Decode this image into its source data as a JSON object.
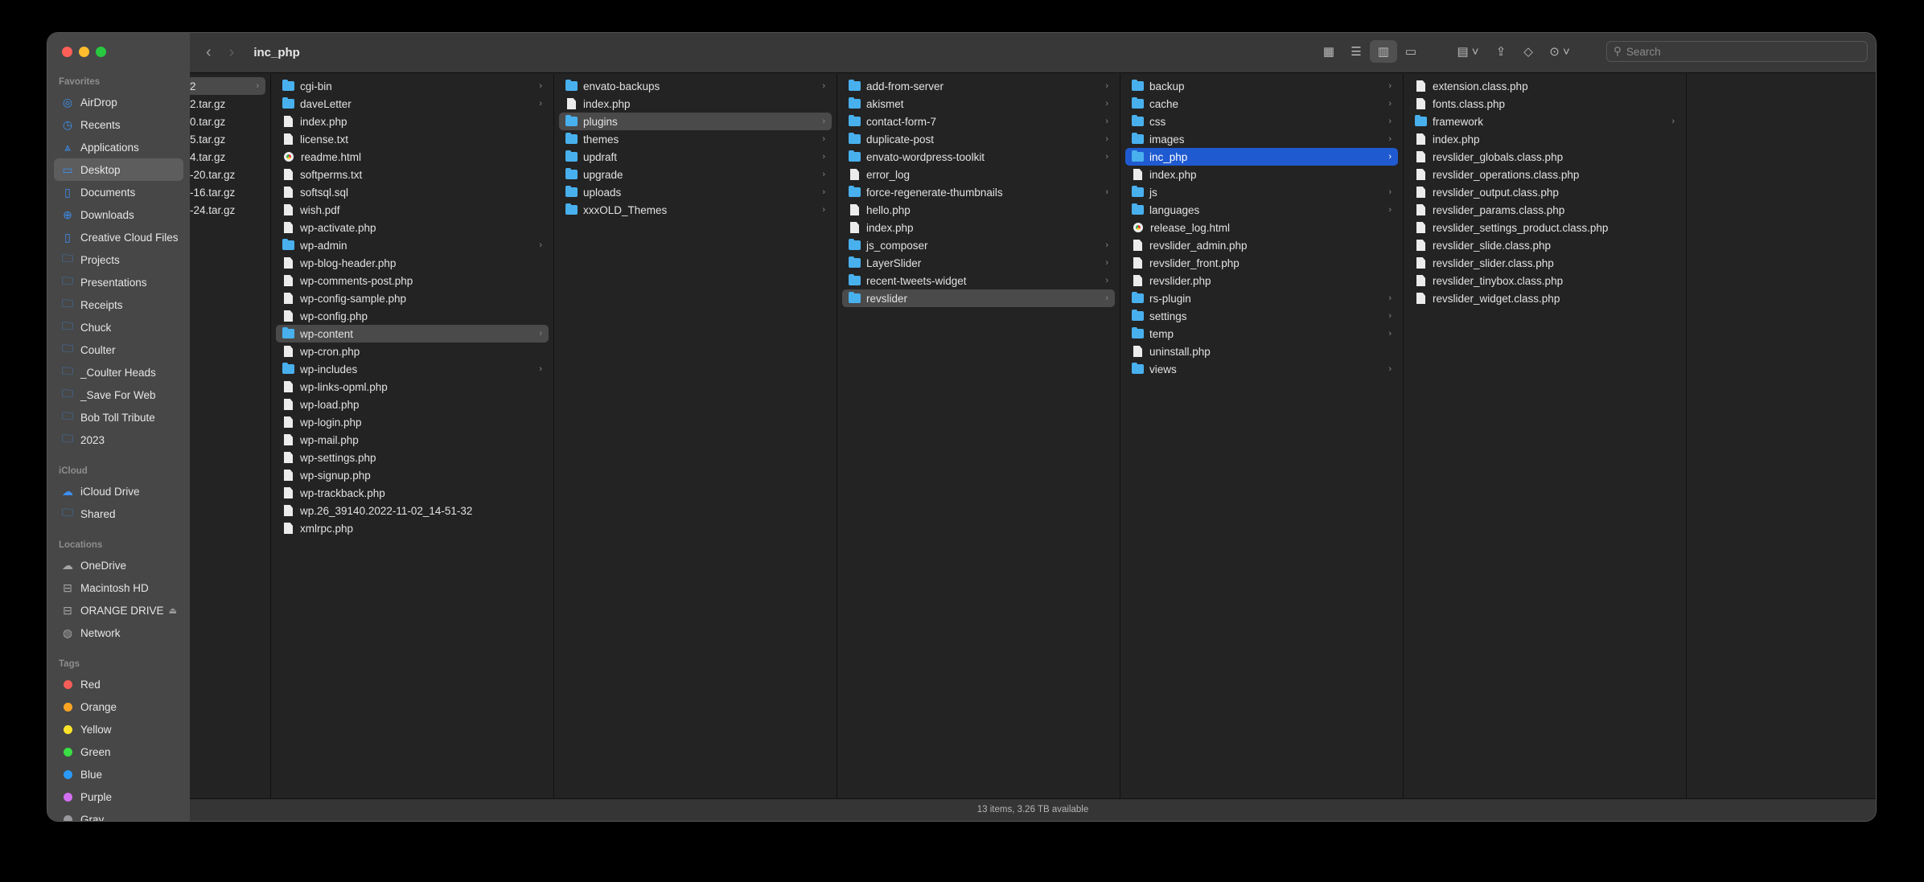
{
  "window": {
    "title": "inc_php",
    "status": "13 items, 3.26 TB available",
    "search_placeholder": "Search"
  },
  "sidebar": {
    "favorites_label": "Favorites",
    "favorites": [
      {
        "label": "AirDrop",
        "icon": "airdrop-icon",
        "glyph": "◎"
      },
      {
        "label": "Recents",
        "icon": "clock-icon",
        "glyph": "◷"
      },
      {
        "label": "Applications",
        "icon": "applications-icon",
        "glyph": "⩓"
      },
      {
        "label": "Desktop",
        "icon": "desktop-icon",
        "glyph": "▭",
        "selected": true
      },
      {
        "label": "Documents",
        "icon": "document-icon",
        "glyph": "▯"
      },
      {
        "label": "Downloads",
        "icon": "download-icon",
        "glyph": "⊕"
      },
      {
        "label": "Creative Cloud Files",
        "icon": "document-icon",
        "glyph": "▯"
      },
      {
        "label": "Projects",
        "icon": "folder-icon",
        "glyph": "🗀"
      },
      {
        "label": "Presentations",
        "icon": "folder-icon",
        "glyph": "🗀"
      },
      {
        "label": "Receipts",
        "icon": "folder-icon",
        "glyph": "🗀"
      },
      {
        "label": "Chuck",
        "icon": "folder-icon",
        "glyph": "🗀"
      },
      {
        "label": "Coulter",
        "icon": "folder-icon",
        "glyph": "🗀"
      },
      {
        "label": "_Coulter Heads",
        "icon": "folder-icon",
        "glyph": "🗀"
      },
      {
        "label": "_Save For Web",
        "icon": "folder-icon",
        "glyph": "🗀"
      },
      {
        "label": "Bob Toll Tribute",
        "icon": "folder-icon",
        "glyph": "🗀"
      },
      {
        "label": "2023",
        "icon": "folder-icon",
        "glyph": "🗀"
      }
    ],
    "icloud_label": "iCloud",
    "icloud": [
      {
        "label": "iCloud Drive",
        "icon": "cloud-icon",
        "glyph": "☁"
      },
      {
        "label": "Shared",
        "icon": "shared-folder-icon",
        "glyph": "🗀"
      }
    ],
    "locations_label": "Locations",
    "locations": [
      {
        "label": "OneDrive",
        "icon": "cloud-icon",
        "glyph": "☁"
      },
      {
        "label": "Macintosh HD",
        "icon": "drive-icon",
        "glyph": "⊟"
      },
      {
        "label": "ORANGE DRIVE",
        "icon": "drive-icon",
        "glyph": "⊟",
        "eject": "⏏"
      },
      {
        "label": "Network",
        "icon": "globe-icon",
        "glyph": "◍"
      }
    ],
    "tags_label": "Tags",
    "tags": [
      {
        "label": "Red",
        "color": "#f55d57"
      },
      {
        "label": "Orange",
        "color": "#f9a423"
      },
      {
        "label": "Yellow",
        "color": "#fde42a"
      },
      {
        "label": "Green",
        "color": "#3ade45"
      },
      {
        "label": "Blue",
        "color": "#2a9af8"
      },
      {
        "label": "Purple",
        "color": "#d46ef0"
      },
      {
        "label": "Gray",
        "color": "#9a9a9e"
      }
    ]
  },
  "columns": [
    [
      {
        "n": "2",
        "t": "sel",
        "d": 1
      },
      {
        "n": "2.tar.gz"
      },
      {
        "n": "0.tar.gz"
      },
      {
        "n": "5.tar.gz"
      },
      {
        "n": "4.tar.gz"
      },
      {
        "n": "-20.tar.gz"
      },
      {
        "n": "-16.tar.gz"
      },
      {
        "n": "-24.tar.gz"
      }
    ],
    [
      {
        "n": "cgi-bin",
        "d": 1
      },
      {
        "n": "daveLetter",
        "d": 1
      },
      {
        "n": "index.php"
      },
      {
        "n": "license.txt"
      },
      {
        "n": "readme.html",
        "h": 1
      },
      {
        "n": "softperms.txt"
      },
      {
        "n": "softsql.sql"
      },
      {
        "n": "wish.pdf"
      },
      {
        "n": "wp-activate.php"
      },
      {
        "n": "wp-admin",
        "d": 1
      },
      {
        "n": "wp-blog-header.php"
      },
      {
        "n": "wp-comments-post.php"
      },
      {
        "n": "wp-config-sample.php"
      },
      {
        "n": "wp-config.php"
      },
      {
        "n": "wp-content",
        "d": 1,
        "t": "sel"
      },
      {
        "n": "wp-cron.php"
      },
      {
        "n": "wp-includes",
        "d": 1
      },
      {
        "n": "wp-links-opml.php"
      },
      {
        "n": "wp-load.php"
      },
      {
        "n": "wp-login.php"
      },
      {
        "n": "wp-mail.php"
      },
      {
        "n": "wp-settings.php"
      },
      {
        "n": "wp-signup.php"
      },
      {
        "n": "wp-trackback.php"
      },
      {
        "n": "wp.26_39140.2022-11-02_14-51-32"
      },
      {
        "n": "xmlrpc.php"
      }
    ],
    [
      {
        "n": "envato-backups",
        "d": 1
      },
      {
        "n": "index.php"
      },
      {
        "n": "plugins",
        "d": 1,
        "t": "sel"
      },
      {
        "n": "themes",
        "d": 1
      },
      {
        "n": "updraft",
        "d": 1
      },
      {
        "n": "upgrade",
        "d": 1
      },
      {
        "n": "uploads",
        "d": 1
      },
      {
        "n": "xxxOLD_Themes",
        "d": 1
      }
    ],
    [
      {
        "n": "add-from-server",
        "d": 1
      },
      {
        "n": "akismet",
        "d": 1
      },
      {
        "n": "contact-form-7",
        "d": 1
      },
      {
        "n": "duplicate-post",
        "d": 1
      },
      {
        "n": "envato-wordpress-toolkit",
        "d": 1
      },
      {
        "n": "error_log"
      },
      {
        "n": "force-regenerate-thumbnails",
        "d": 1
      },
      {
        "n": "hello.php"
      },
      {
        "n": "index.php"
      },
      {
        "n": "js_composer",
        "d": 1
      },
      {
        "n": "LayerSlider",
        "d": 1
      },
      {
        "n": "recent-tweets-widget",
        "d": 1
      },
      {
        "n": "revslider",
        "d": 1,
        "t": "sel"
      }
    ],
    [
      {
        "n": "backup",
        "d": 1
      },
      {
        "n": "cache",
        "d": 1
      },
      {
        "n": "css",
        "d": 1
      },
      {
        "n": "images",
        "d": 1
      },
      {
        "n": "inc_php",
        "d": 1,
        "t": "act"
      },
      {
        "n": "index.php"
      },
      {
        "n": "js",
        "d": 1
      },
      {
        "n": "languages",
        "d": 1
      },
      {
        "n": "release_log.html",
        "h": 1
      },
      {
        "n": "revslider_admin.php"
      },
      {
        "n": "revslider_front.php"
      },
      {
        "n": "revslider.php"
      },
      {
        "n": "rs-plugin",
        "d": 1
      },
      {
        "n": "settings",
        "d": 1
      },
      {
        "n": "temp",
        "d": 1
      },
      {
        "n": "uninstall.php"
      },
      {
        "n": "views",
        "d": 1
      }
    ],
    [
      {
        "n": "extension.class.php"
      },
      {
        "n": "fonts.class.php"
      },
      {
        "n": "framework",
        "d": 1
      },
      {
        "n": "index.php"
      },
      {
        "n": "revslider_globals.class.php"
      },
      {
        "n": "revslider_operations.class.php"
      },
      {
        "n": "revslider_output.class.php"
      },
      {
        "n": "revslider_params.class.php"
      },
      {
        "n": "revslider_settings_product.class.php"
      },
      {
        "n": "revslider_slide.class.php"
      },
      {
        "n": "revslider_slider.class.php"
      },
      {
        "n": "revslider_tinybox.class.php"
      },
      {
        "n": "revslider_widget.class.php"
      }
    ],
    []
  ]
}
